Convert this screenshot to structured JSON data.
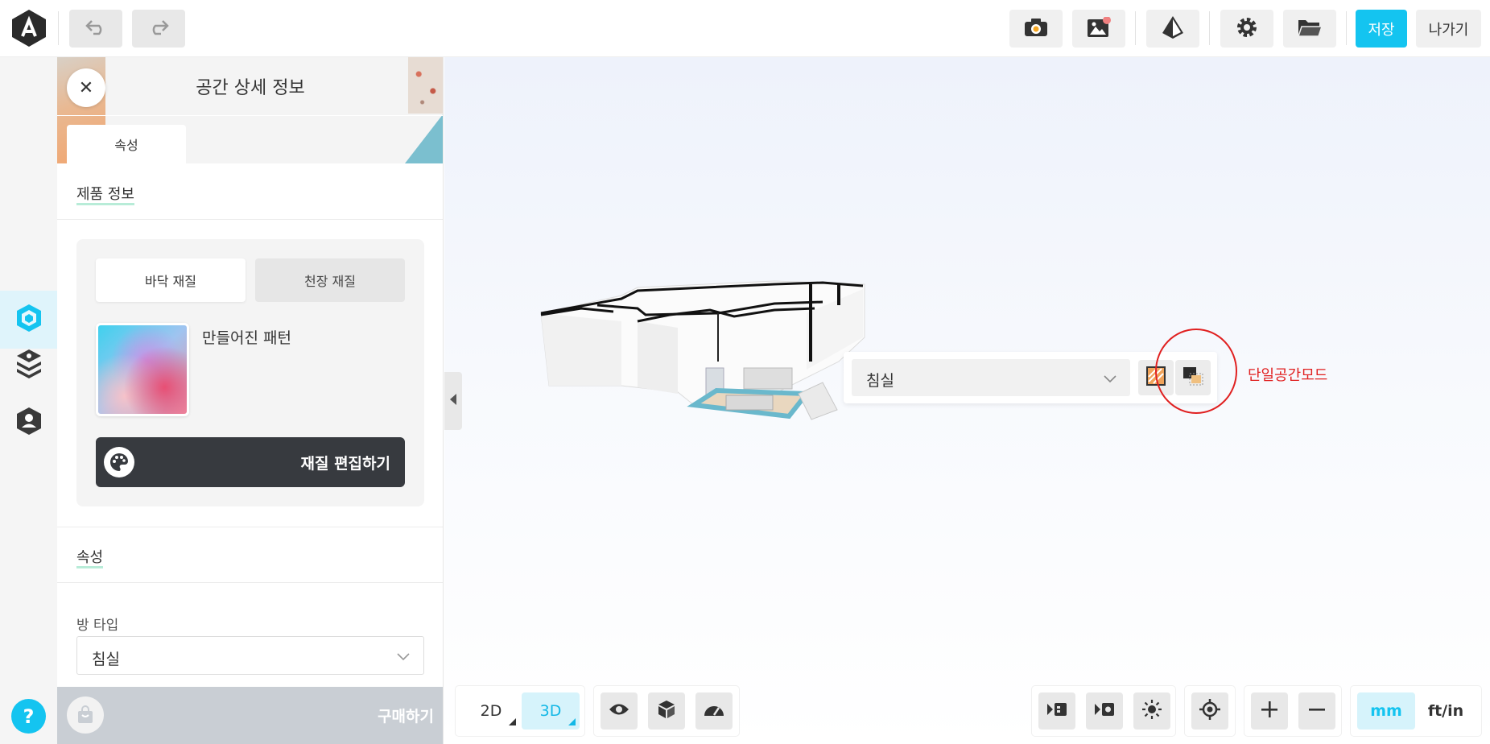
{
  "header": {
    "save_label": "저장",
    "exit_label": "나가기"
  },
  "panel": {
    "title": "공간 상세 정보",
    "tabs": [
      {
        "label": "속성"
      }
    ],
    "product_info_title": "제품 정보",
    "material": {
      "tabs": [
        {
          "label": "바닥 재질"
        },
        {
          "label": "천장 재질"
        }
      ],
      "swatch_name": "만들어진 패턴",
      "edit_label": "재질 편집하기"
    },
    "attributes_title": "속성",
    "room_type_label": "방 타입",
    "room_type_value": "침실",
    "buy_label": "구매하기"
  },
  "viewport": {
    "room_select_value": "침실",
    "annotation_label": "단일공간모드"
  },
  "bottom_toolbar": {
    "view_modes": [
      {
        "label": "2D"
      },
      {
        "label": "3D"
      }
    ],
    "units": [
      {
        "label": "mm"
      },
      {
        "label": "ft/in"
      }
    ],
    "active_view": "3D",
    "active_unit": "mm"
  },
  "colors": {
    "accent": "#14c4f0",
    "annotation": "#e02020",
    "dark_button": "#373a3f"
  }
}
